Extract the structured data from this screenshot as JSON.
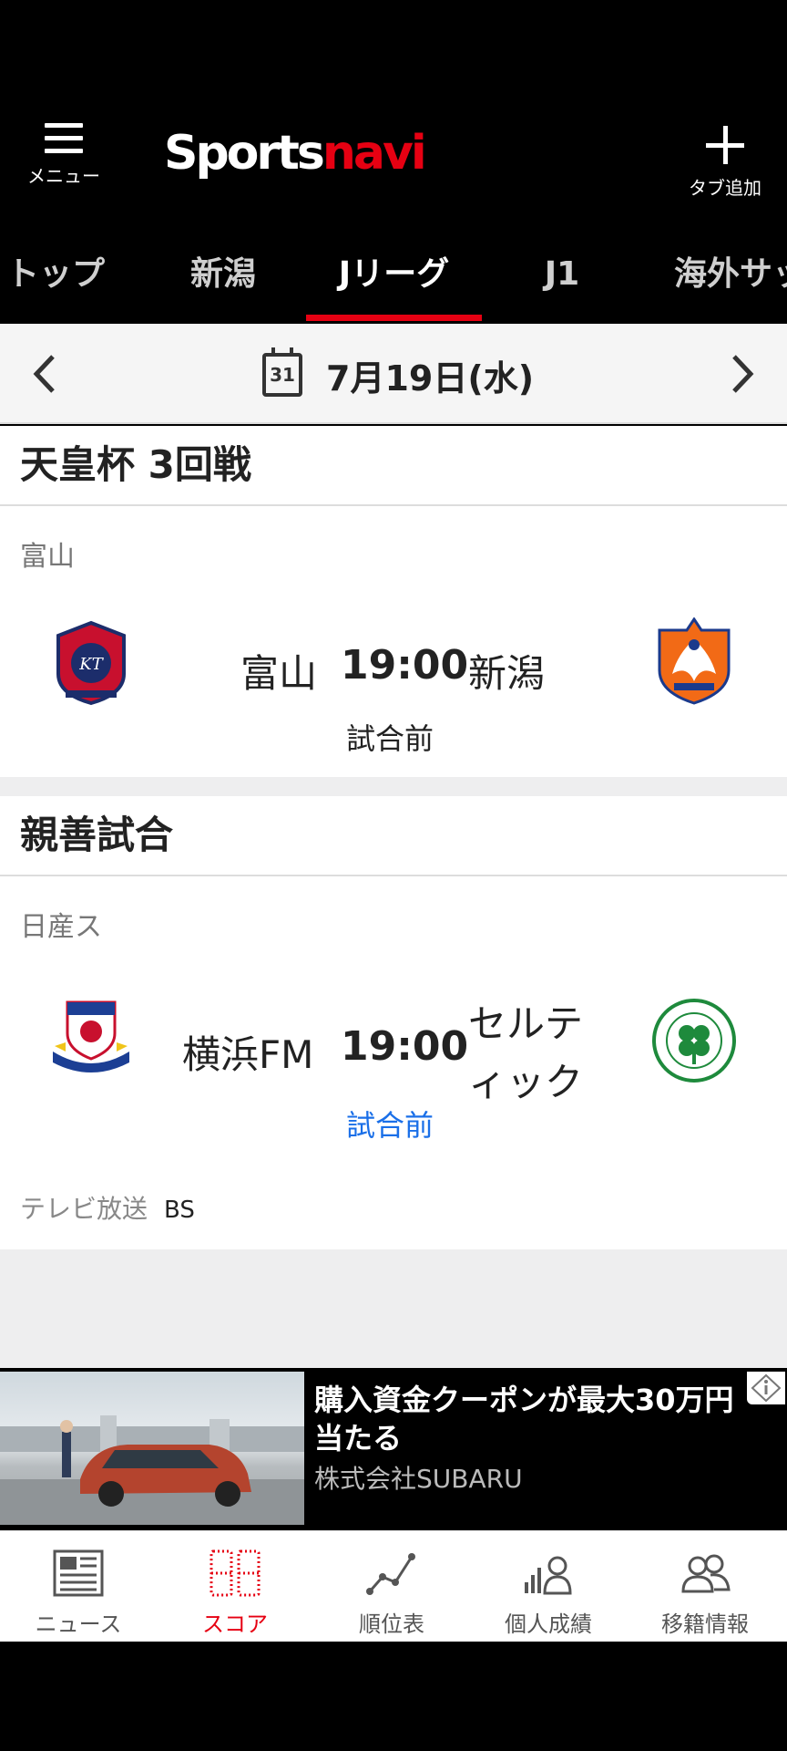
{
  "header": {
    "menu_label": "メニュー",
    "logo_part1": "Sports",
    "logo_part2": "navi",
    "add_tab_label": "タブ追加"
  },
  "tabs": [
    {
      "label": "トップ",
      "active": false
    },
    {
      "label": "新潟",
      "active": false
    },
    {
      "label": "Jリーグ",
      "active": true
    },
    {
      "label": "J1",
      "active": false
    },
    {
      "label": "海外サッ",
      "active": false
    }
  ],
  "datebar": {
    "calendar_day": "31",
    "date": "7月19日(水)"
  },
  "sections": [
    {
      "title": "天皇杯 3回戦",
      "matches": [
        {
          "venue": "富山",
          "home": "富山",
          "time": "19:00",
          "away": "新潟",
          "status": "試合前"
        }
      ]
    },
    {
      "title": "親善試合",
      "matches": [
        {
          "venue": "日産ス",
          "home": "横浜FM",
          "time": "19:00",
          "away_line1": "セルテ",
          "away_line2": "ィック",
          "status": "試合前",
          "tv_label": "テレビ放送",
          "tv_value": "BS"
        }
      ]
    }
  ],
  "ad": {
    "title": "購入資金クーポンが最大30万円当たる",
    "company": "株式会社SUBARU"
  },
  "bottom_nav": [
    {
      "label": "ニュース",
      "icon": "news-icon",
      "active": false
    },
    {
      "label": "スコア",
      "icon": "score-icon",
      "active": true
    },
    {
      "label": "順位表",
      "icon": "standings-icon",
      "active": false
    },
    {
      "label": "個人成績",
      "icon": "player-stats-icon",
      "active": false
    },
    {
      "label": "移籍情報",
      "icon": "transfer-icon",
      "active": false
    }
  ],
  "colors": {
    "accent": "#e60012",
    "link_blue": "#1a6fe8"
  }
}
